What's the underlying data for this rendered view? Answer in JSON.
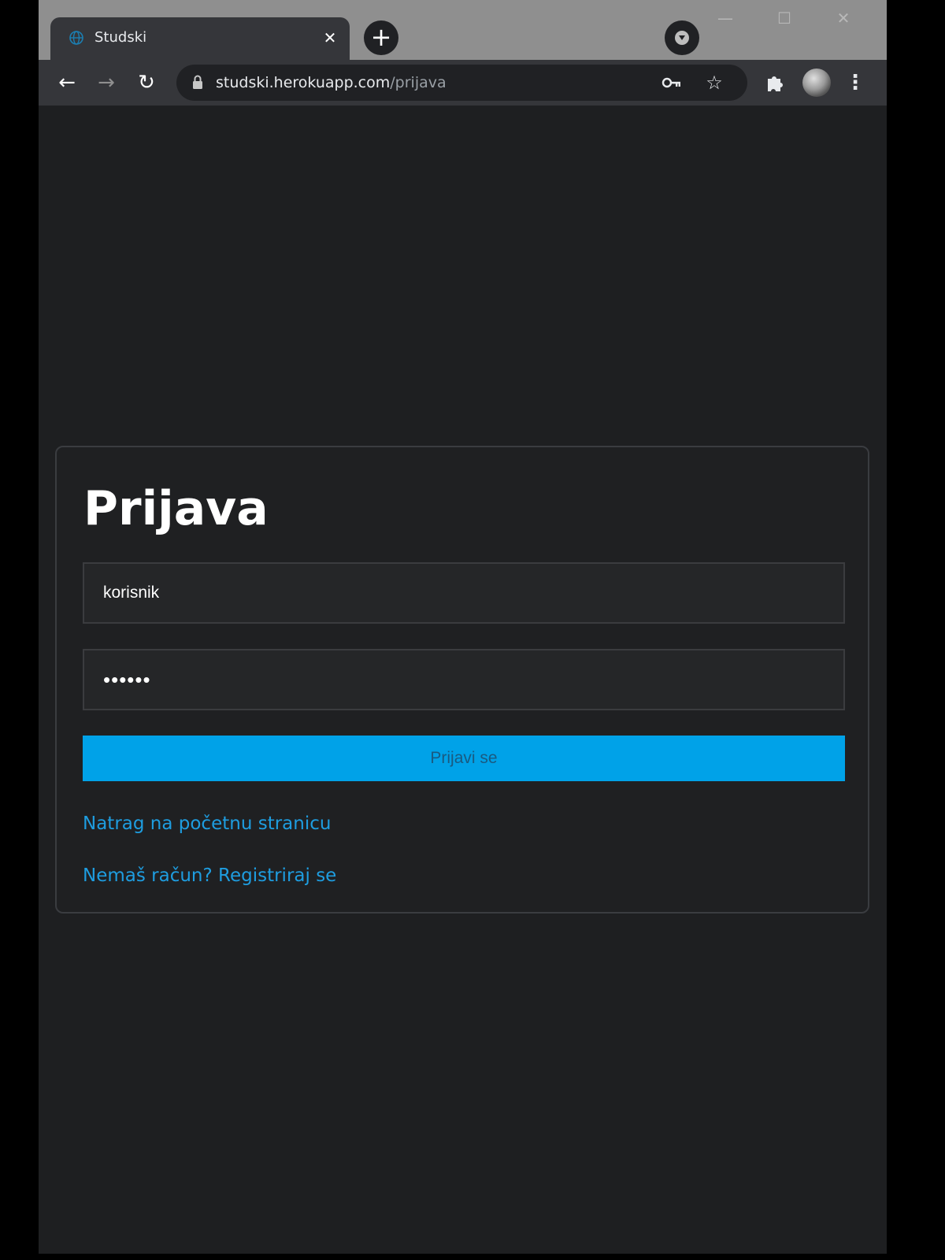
{
  "browser": {
    "tab": {
      "title": "Studski",
      "close_glyph": "✕",
      "favicon": "globe-icon"
    },
    "new_tab_glyph": "+",
    "window_controls": {
      "minimize_glyph": "—",
      "maximize_glyph": "☐",
      "close_glyph": "✕"
    },
    "toolbar": {
      "back_glyph": "←",
      "forward_glyph": "→",
      "reload_glyph": "↻",
      "url_host": "studski.herokuapp.com",
      "url_path": "/prijava",
      "star_glyph": "☆",
      "menu_glyph": "⋮"
    }
  },
  "login": {
    "title": "Prijava",
    "username_value": "korisnik",
    "password_value": "••••••",
    "submit_label": "Prijavi se",
    "back_link": "Natrag na početnu stranicu",
    "register_link": "Nemaš račun? Registriraj se"
  },
  "colors": {
    "page_background": "#1e1f21",
    "accent": "#00a2e8",
    "link": "#1e9de0"
  }
}
